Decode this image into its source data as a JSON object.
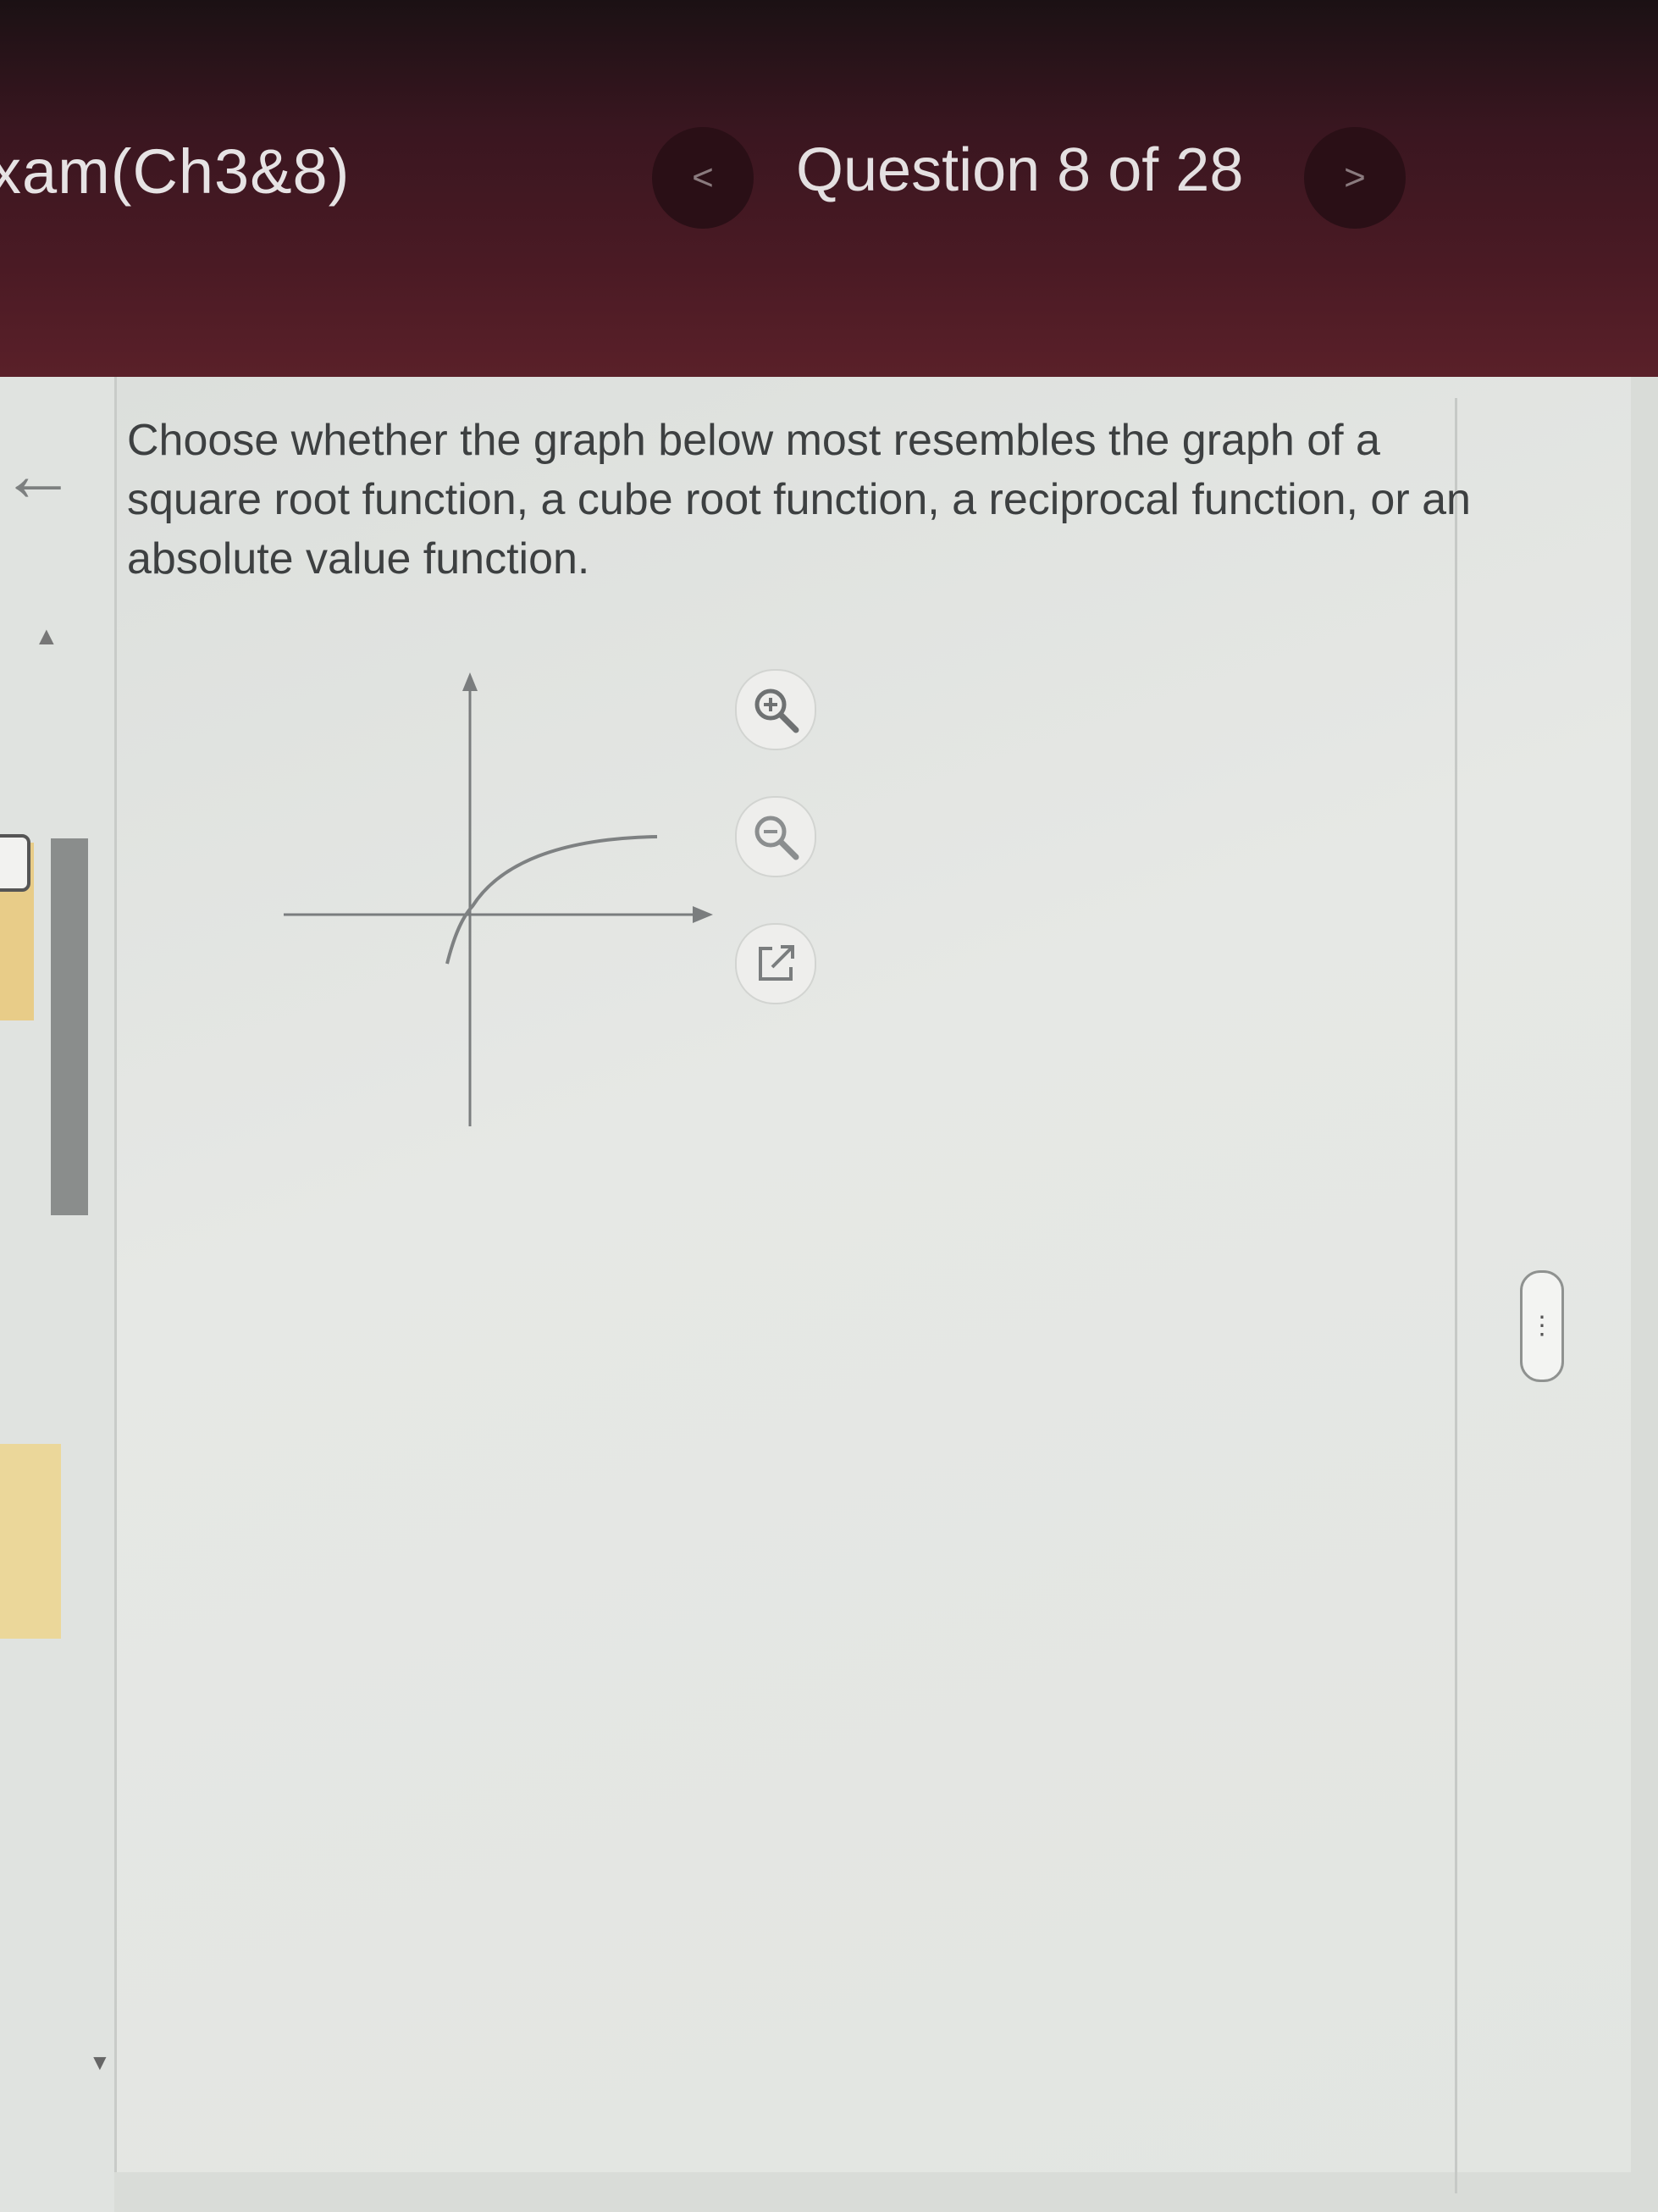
{
  "header": {
    "exam_title": "xam(Ch3&8)",
    "question_counter": "Question 8 of 28",
    "prev_label": "<",
    "next_label": ">"
  },
  "sidebar": {
    "back_icon": "arrow-left-icon"
  },
  "question": {
    "text": "Choose whether the graph below most resembles the graph of a square root function, a cube root function, a reciprocal function, or an absolute value function."
  },
  "graph_tools": {
    "zoom_in_icon": "zoom-in-icon",
    "zoom_out_icon": "zoom-out-icon",
    "popout_icon": "open-in-new-window-icon"
  },
  "more_options_label": "⋮",
  "colors": {
    "header_bg": "#3a1620",
    "panel_bg": "#e4e6e3",
    "text": "#3d4041",
    "accent_yellow": "#e8cc88"
  }
}
